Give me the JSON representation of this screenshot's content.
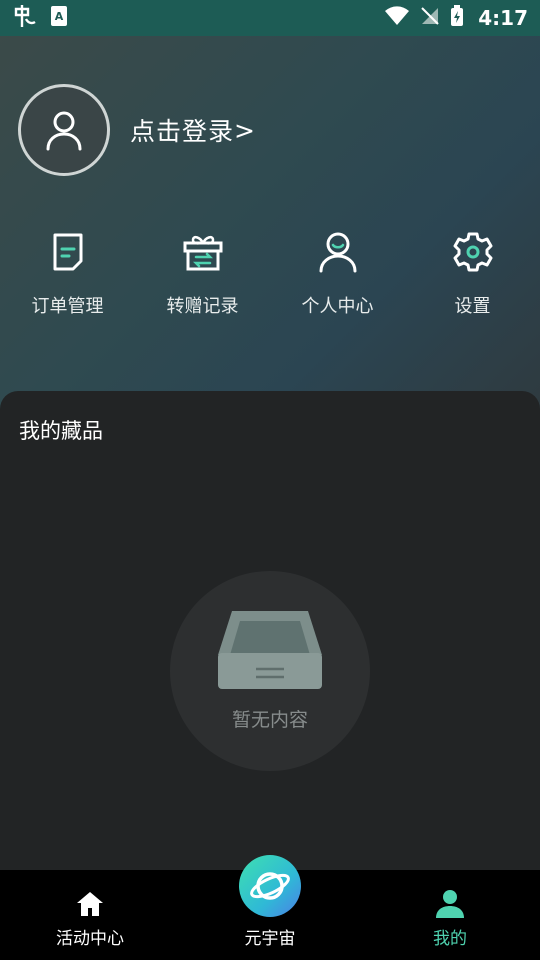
{
  "status_bar": {
    "time": "4:17"
  },
  "profile": {
    "login_text": "点击登录",
    "chevron": ">"
  },
  "quick_actions": [
    {
      "label": "订单管理",
      "icon": "order-doc-icon"
    },
    {
      "label": "转赠记录",
      "icon": "gift-transfer-icon"
    },
    {
      "label": "个人中心",
      "icon": "person-smile-icon"
    },
    {
      "label": "设置",
      "icon": "gear-icon"
    }
  ],
  "collection": {
    "title": "我的藏品",
    "empty_text": "暂无内容"
  },
  "tabs": [
    {
      "label": "活动中心",
      "icon": "home-icon"
    },
    {
      "label": "元宇宙",
      "icon": "planet-icon"
    },
    {
      "label": "我的",
      "icon": "user-icon",
      "active": true
    }
  ],
  "colors": {
    "accent": "#4fd3b0",
    "status_bar": "#1d5c55",
    "card_bg": "#222425"
  }
}
